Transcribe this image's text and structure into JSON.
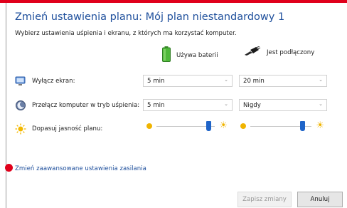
{
  "window": {
    "accent_color": "#e0001b",
    "title": "Zmień ustawienia planu: Mój plan niestandardowy 1",
    "subtitle": "Wybierz ustawienia uśpienia i ekranu, z których ma korzystać komputer."
  },
  "columns": {
    "battery": {
      "label": "Używa baterii",
      "icon": "battery-icon"
    },
    "plugged": {
      "label": "Jest podłączony",
      "icon": "plug-icon"
    }
  },
  "rows": {
    "display": {
      "label": "Wyłącz ekran:",
      "icon": "monitor-icon",
      "battery_value": "5 min",
      "plugged_value": "20 min"
    },
    "sleep": {
      "label": "Przełącz komputer w tryb uśpienia:",
      "icon": "moon-sleep-icon",
      "battery_value": "5 min",
      "plugged_value": "Nigdy"
    },
    "brightness": {
      "label": "Dopasuj jasność planu:",
      "icon": "sun-icon",
      "battery_level": 0.9,
      "plugged_level": 0.85
    }
  },
  "advanced_link": "Zmień zaawansowane ustawienia zasilania",
  "buttons": {
    "save": "Zapisz zmiany",
    "cancel": "Anuluj"
  }
}
